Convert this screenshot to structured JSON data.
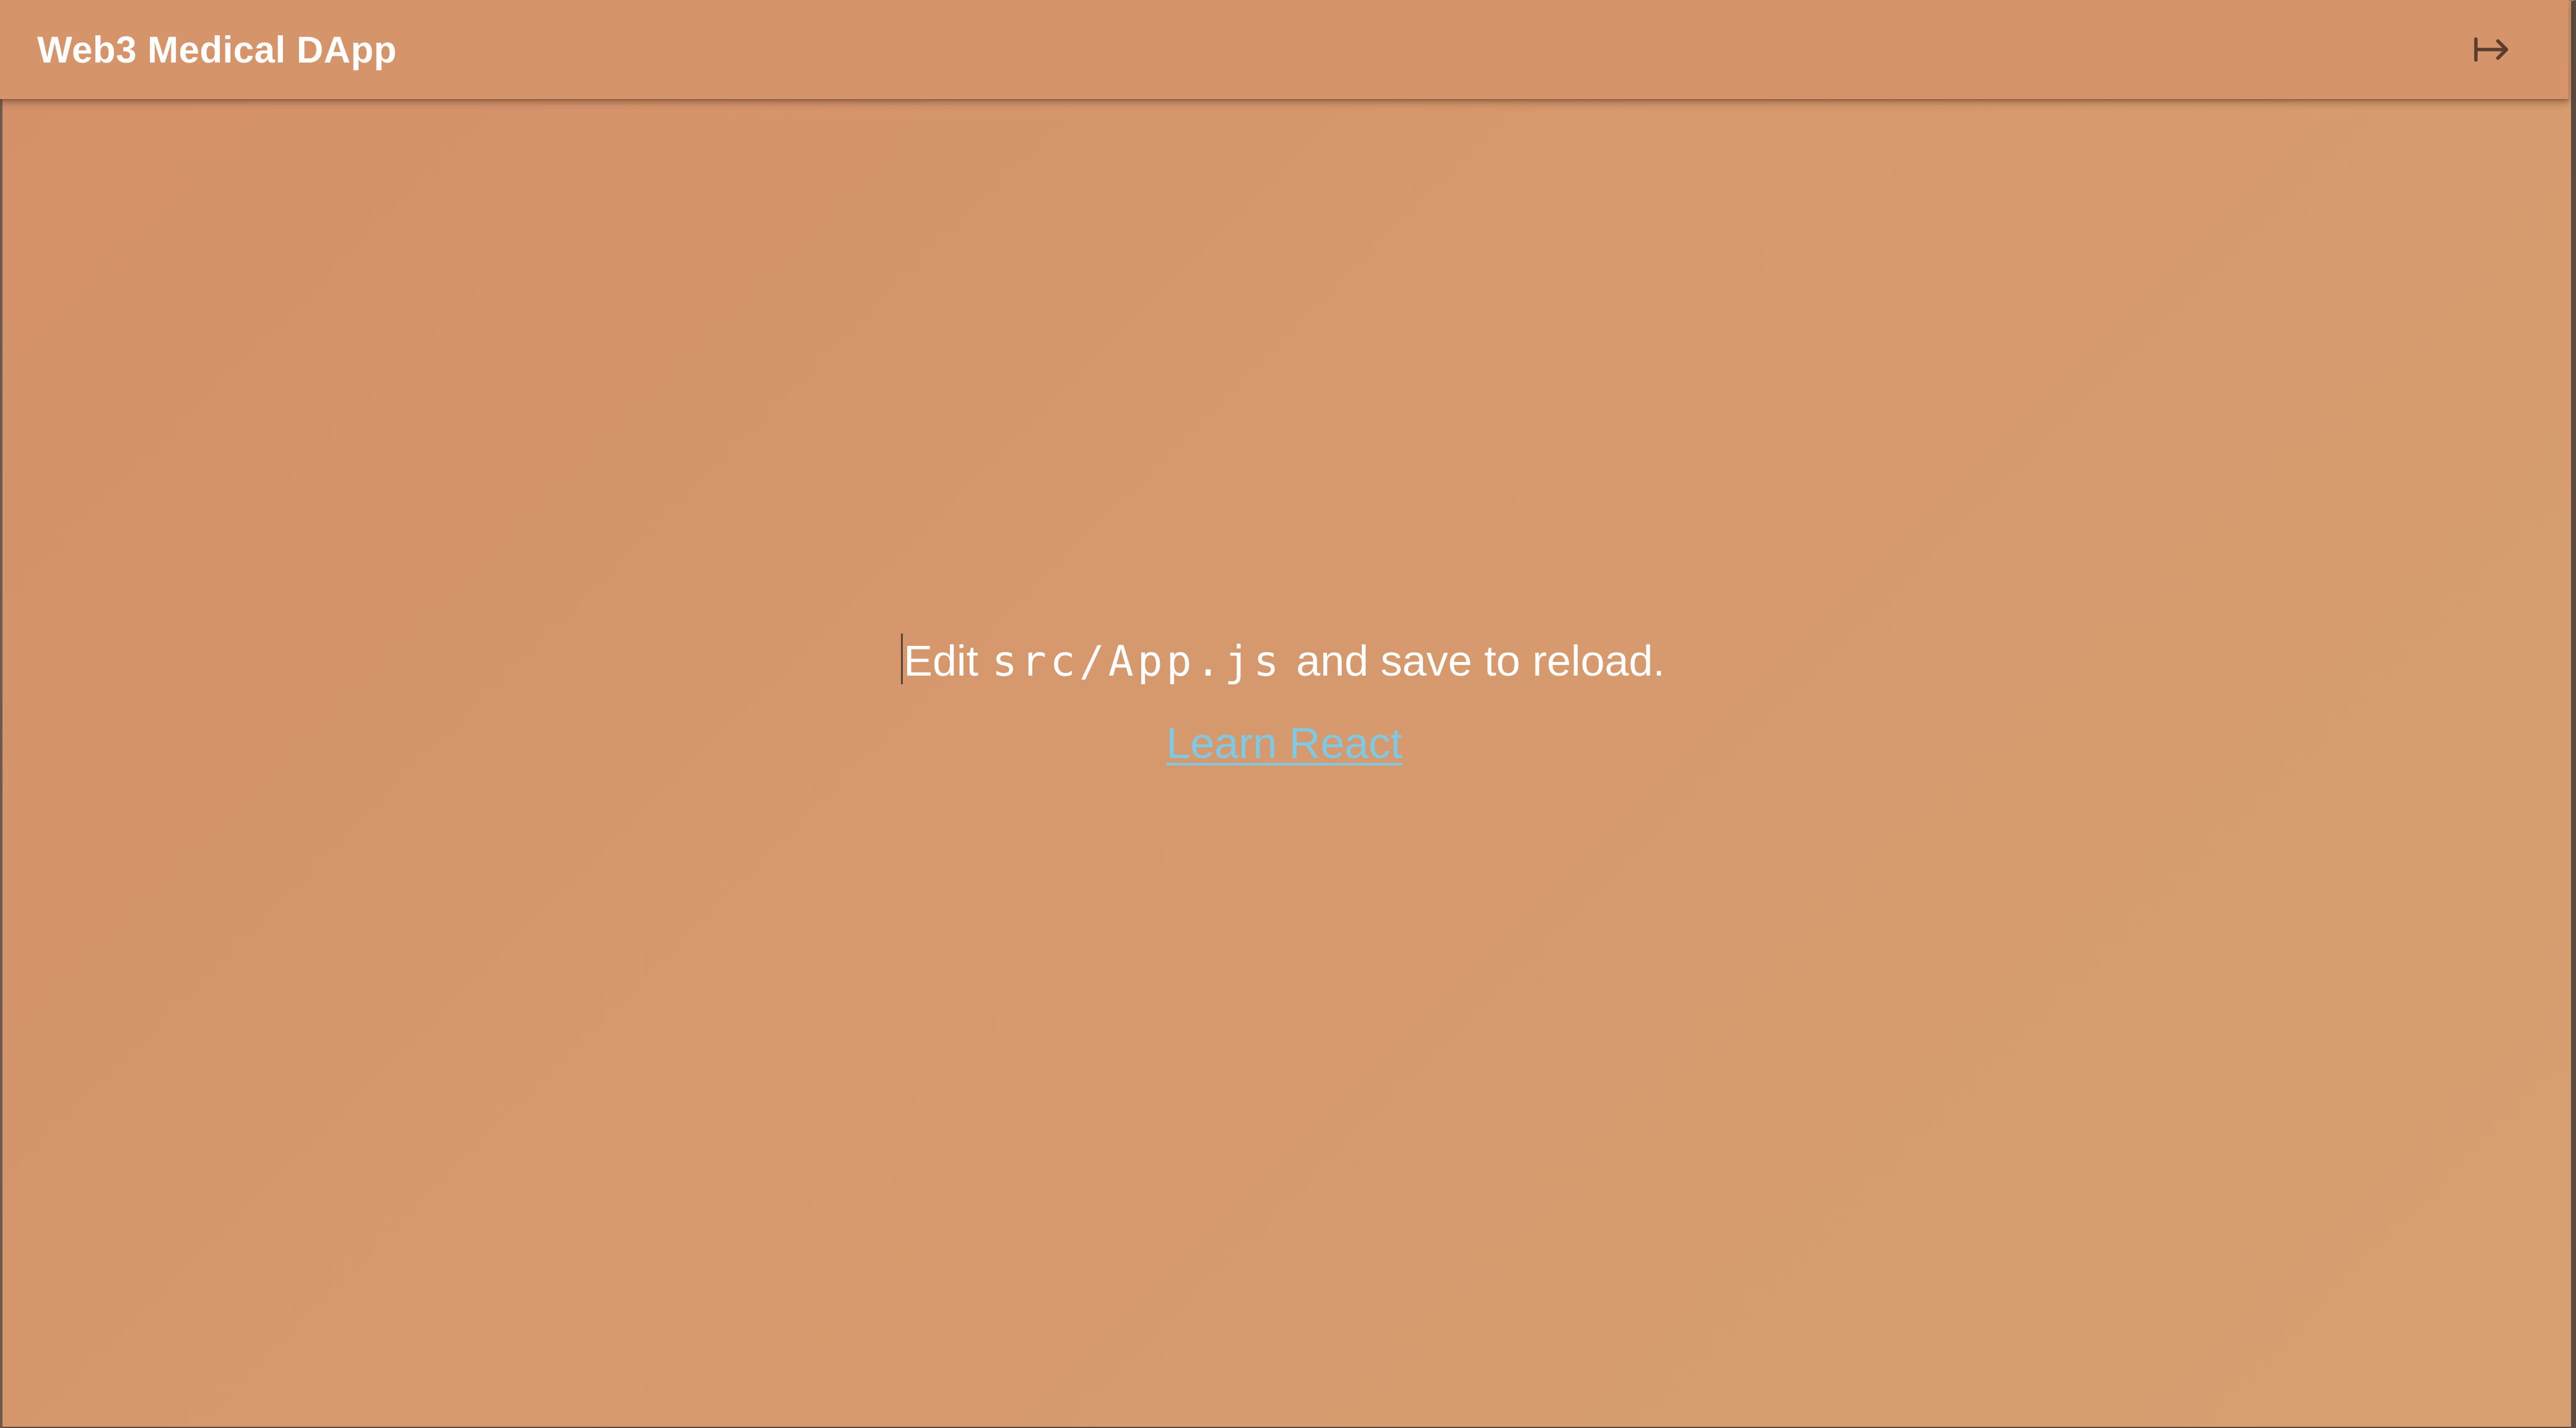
{
  "header": {
    "title": "Web3 Medical DApp",
    "logout_icon": "logout-arrow-icon"
  },
  "main": {
    "edit_prefix": "Edit",
    "code_path": "src/App.js",
    "edit_suffix": "and save to reload.",
    "link_label": "Learn React"
  },
  "colors": {
    "background": "#d6996d",
    "appbar": "#d5946a",
    "text": "#ffffff",
    "link": "#7ecae6"
  }
}
